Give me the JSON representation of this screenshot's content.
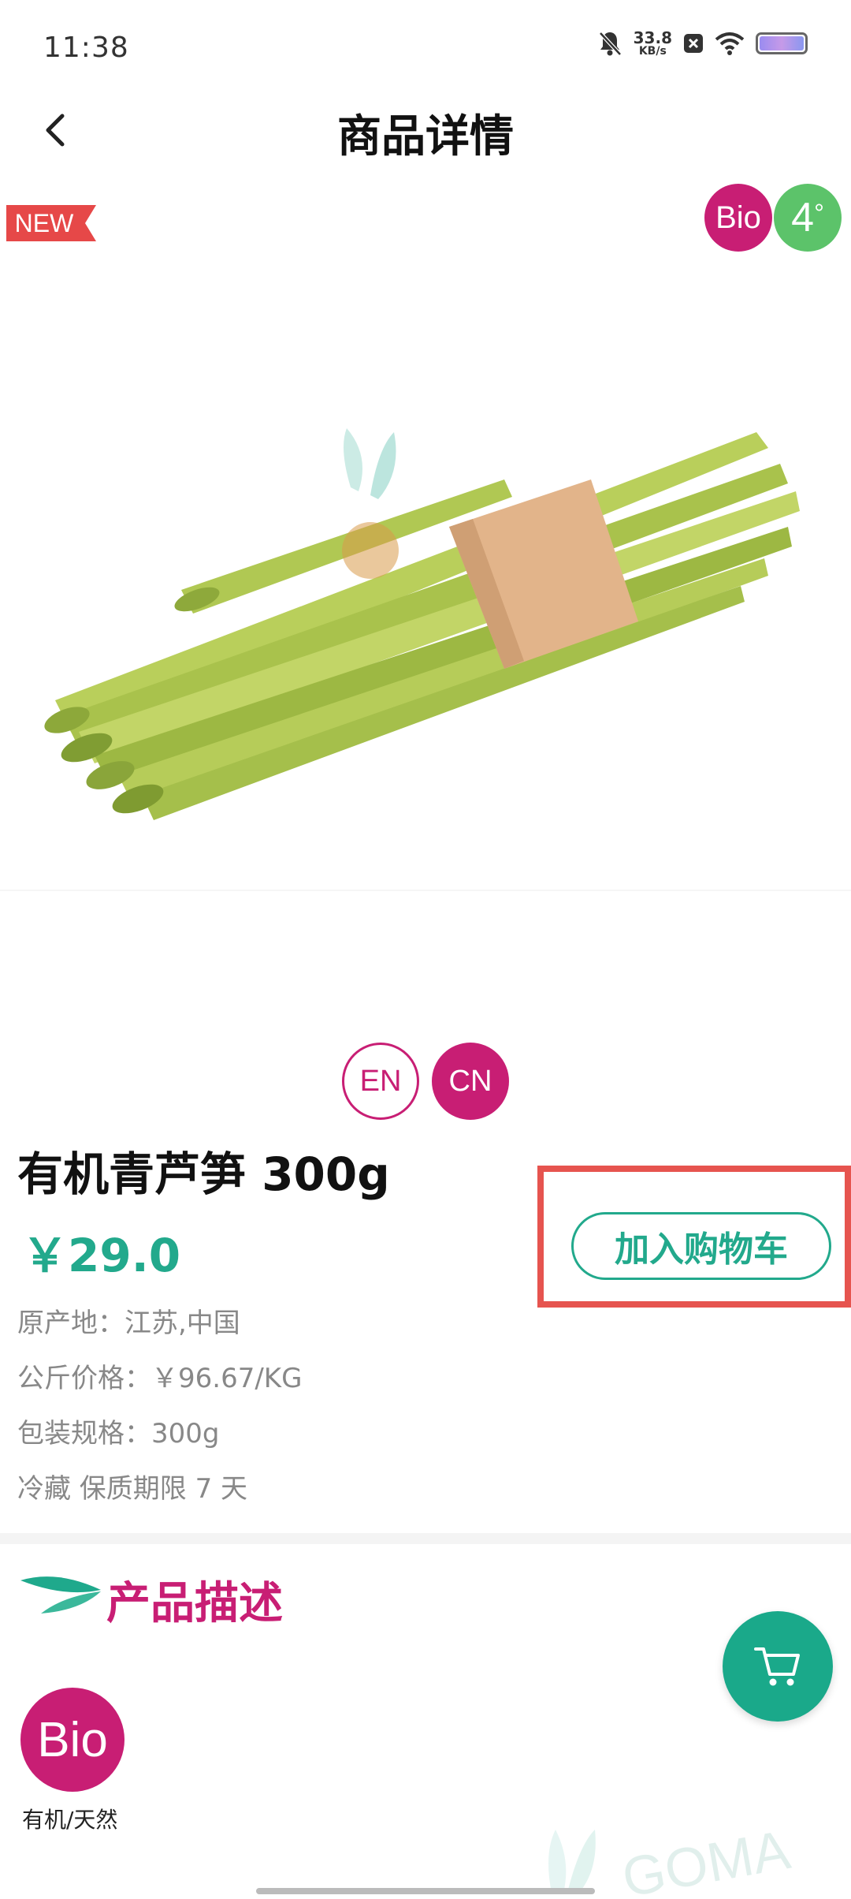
{
  "status_bar": {
    "time": "11:38",
    "net_speed_value": "33.8",
    "net_speed_unit": "KB/s",
    "icons": [
      "bell-muted-icon",
      "close-box-icon",
      "wifi-icon",
      "battery-icon"
    ]
  },
  "header": {
    "title": "商品详情"
  },
  "badges": {
    "new_label": "NEW",
    "bio_label": "Bio",
    "temp_label": "4",
    "temp_degree": "°"
  },
  "language_toggle": {
    "en": "EN",
    "cn": "CN",
    "selected": "CN"
  },
  "product": {
    "name": "有机青芦笋 300g",
    "price": "￥29.0",
    "origin": "原产地：江苏,中国",
    "price_per_kg": "公斤价格：￥96.67/KG",
    "package": "包装规格：300g",
    "storage": "冷藏 保质期限 7 天",
    "add_to_cart": "加入购物车"
  },
  "description": {
    "title": "产品描述",
    "bio_label": "Bio",
    "bio_caption": "有机/天然"
  },
  "watermark_text": "GOMA",
  "colors": {
    "brand_magenta": "#c81e74",
    "brand_green": "#22a98c",
    "highlight_red": "#e6544f",
    "temp_green": "#5cc36a"
  }
}
